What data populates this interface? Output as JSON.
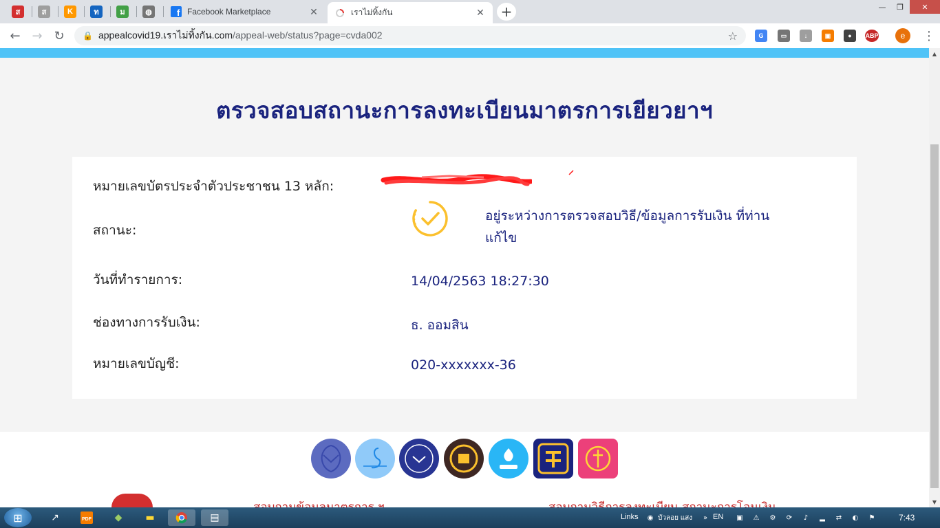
{
  "browser": {
    "pinned_tabs": [
      {
        "icon": "news-red-icon",
        "glyph": "ส",
        "color": "#d32f2f"
      },
      {
        "icon": "link-icon",
        "glyph": "ส",
        "color": "#9e9e9e"
      },
      {
        "icon": "k-logo-icon",
        "glyph": "K",
        "color": "#ff9800"
      },
      {
        "icon": "thai-news-icon",
        "glyph": "ท",
        "color": "#1565c0"
      },
      {
        "icon": "green-m-icon",
        "glyph": "ม",
        "color": "#43a047"
      },
      {
        "icon": "globe-icon",
        "glyph": "◍",
        "color": "#757575"
      }
    ],
    "tabs": [
      {
        "title": "Facebook Marketplace",
        "close": "✕"
      },
      {
        "title": "เราไม่ทิ้งกัน",
        "close": "✕"
      }
    ],
    "new_tab": "+",
    "window_controls": {
      "minimize": "—",
      "restore": "❐",
      "close": "✕"
    },
    "url_host": "appealcovid19.เราไม่ทิ้งกัน.com",
    "url_path": "/appeal-web/status?page=cvda002",
    "extensions": [
      {
        "icon": "translate-icon",
        "glyph": "G",
        "color": "#4285f4"
      },
      {
        "icon": "chat-icon",
        "glyph": "▭",
        "color": "#757575"
      },
      {
        "icon": "download-icon",
        "glyph": "↓",
        "color": "#9e9e9e"
      },
      {
        "icon": "screenshot-icon",
        "glyph": "▣",
        "color": "#f57c00"
      },
      {
        "icon": "eyes-icon",
        "glyph": "●",
        "color": "#424242"
      },
      {
        "icon": "adblock-icon",
        "glyph": "ABP",
        "color": "#c62828"
      }
    ],
    "profile_initial": "e"
  },
  "page": {
    "title": "ตรวจสอบสถานะการลงทะเบียนมาตรการเยียวยาฯ",
    "rows": {
      "id_label": "หมายเลขบัตรประจำตัวประชาชน 13 หลัก:",
      "status_label": "สถานะ:",
      "status_value": "อยู่ระหว่างการตรวจสอบวิธี/ข้อมูลการรับเงิน ที่ท่านแก้ไข",
      "date_label": "วันที่ทำรายการ:",
      "date_value": "14/04/2563 18:27:30",
      "channel_label": "ช่องทางการรับเงิน:",
      "channel_value": "ธ. ออมสิน",
      "account_label": "หมายเลขบัญชี:",
      "account_value": "020-xxxxxxx-36"
    },
    "colors": {
      "accent": "#1a237e",
      "status": "#fbc02d",
      "band": "#4fc3f7"
    },
    "logos": [
      {
        "icon": "comptroller-garuda-logo",
        "color": "#5c6bc0"
      },
      {
        "icon": "swan-logo",
        "color": "#90caf9"
      },
      {
        "icon": "ministry-of-finance-logo",
        "color": "#283593"
      },
      {
        "icon": "seal-gold-logo",
        "color": "#3e2723"
      },
      {
        "icon": "krungthai-logo",
        "color": "#29b6f6"
      },
      {
        "icon": "baac-logo",
        "color": "#1a237e"
      },
      {
        "icon": "gsb-logo",
        "color": "#ec407a"
      }
    ],
    "footer_links": [
      "สอบถามข้อมูลมาตรการ ฯ",
      "สอบถามวิธีการลงทะเบียน สถานะการโอนเงิน"
    ]
  },
  "taskbar": {
    "links_label": "Links",
    "user_label": "บัวลอย แสง",
    "lang": "EN",
    "time": "7:43"
  }
}
